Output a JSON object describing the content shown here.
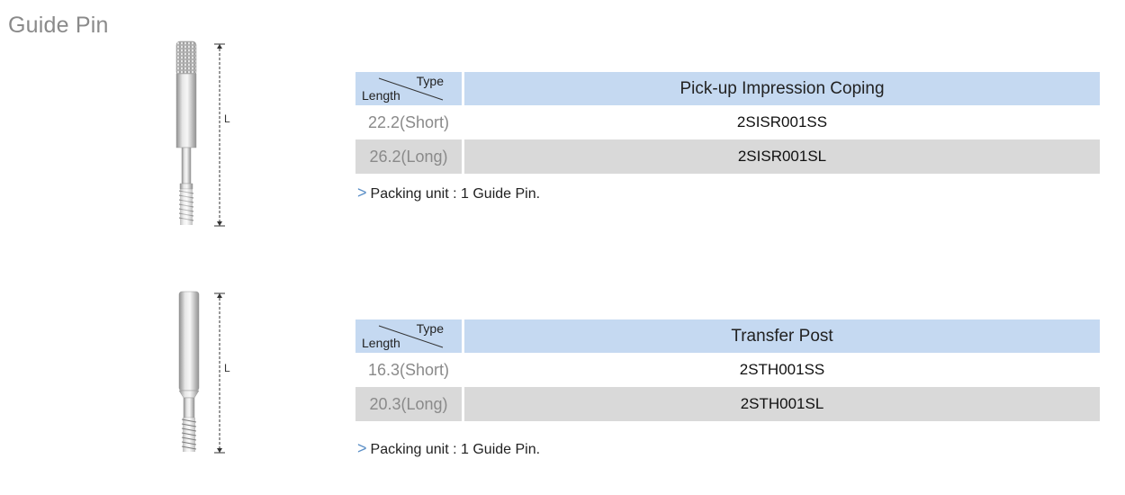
{
  "page": {
    "title": "Guide Pin"
  },
  "products": [
    {
      "dimension_label": "L",
      "table": {
        "corner_type": "Type",
        "corner_length": "Length",
        "header": "Pick-up Impression Coping",
        "rows": [
          {
            "length": "22.2(Short)",
            "code": "2SISR001SS"
          },
          {
            "length": "26.2(Long)",
            "code": "2SISR001SL"
          }
        ]
      },
      "packing_arrow": ">",
      "packing": "Packing unit : 1 Guide Pin."
    },
    {
      "dimension_label": "L",
      "table": {
        "corner_type": "Type",
        "corner_length": "Length",
        "header": "Transfer Post",
        "rows": [
          {
            "length": "16.3(Short)",
            "code": "2STH001SS"
          },
          {
            "length": "20.3(Long)",
            "code": "2STH001SL"
          }
        ]
      },
      "packing_arrow": ">",
      "packing": "Packing unit : 1 Guide Pin."
    }
  ]
}
